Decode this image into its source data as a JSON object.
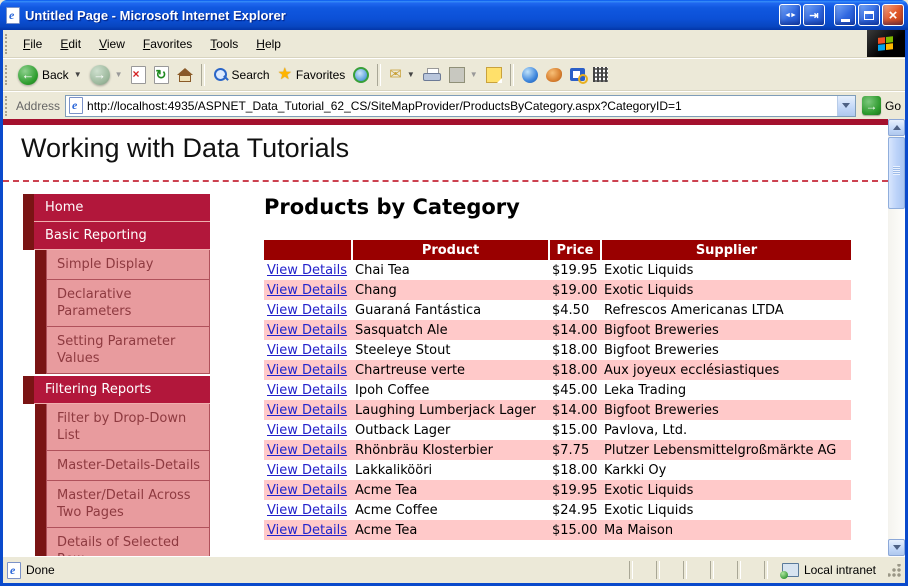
{
  "window": {
    "title": "Untitled Page - Microsoft Internet Explorer"
  },
  "menu_bar": {
    "items": [
      "File",
      "Edit",
      "View",
      "Favorites",
      "Tools",
      "Help"
    ]
  },
  "toolbar": {
    "back_label": "Back",
    "search_label": "Search",
    "favorites_label": "Favorites"
  },
  "address_bar": {
    "label": "Address",
    "url": "http://localhost:4935/ASPNET_Data_Tutorial_62_CS/SiteMapProvider/ProductsByCategory.aspx?CategoryID=1",
    "go_label": "Go"
  },
  "page": {
    "site_title": "Working with Data Tutorials",
    "heading": "Products by Category",
    "sidebar": [
      {
        "label": "Home",
        "level": 1
      },
      {
        "label": "Basic Reporting",
        "level": 1
      },
      {
        "label": "Simple Display",
        "level": 2
      },
      {
        "label": "Declarative Parameters",
        "level": 2
      },
      {
        "label": "Setting Parameter Values",
        "level": 2
      },
      {
        "label": "Filtering Reports",
        "level": 1
      },
      {
        "label": "Filter by Drop-Down List",
        "level": 2
      },
      {
        "label": "Master-Details-Details",
        "level": 2
      },
      {
        "label": "Master/Detail Across Two Pages",
        "level": 2
      },
      {
        "label": "Details of Selected Row",
        "level": 2
      }
    ],
    "table": {
      "headers": [
        "",
        "Product",
        "Price",
        "Supplier"
      ],
      "link_label": "View Details",
      "rows": [
        {
          "product": "Chai Tea",
          "price": "$19.95",
          "supplier": "Exotic Liquids"
        },
        {
          "product": "Chang",
          "price": "$19.00",
          "supplier": "Exotic Liquids"
        },
        {
          "product": "Guaraná Fantástica",
          "price": "$4.50",
          "supplier": "Refrescos Americanas LTDA"
        },
        {
          "product": "Sasquatch Ale",
          "price": "$14.00",
          "supplier": "Bigfoot Breweries"
        },
        {
          "product": "Steeleye Stout",
          "price": "$18.00",
          "supplier": "Bigfoot Breweries"
        },
        {
          "product": "Chartreuse verte",
          "price": "$18.00",
          "supplier": "Aux joyeux ecclésiastiques"
        },
        {
          "product": "Ipoh Coffee",
          "price": "$45.00",
          "supplier": "Leka Trading"
        },
        {
          "product": "Laughing Lumberjack Lager",
          "price": "$14.00",
          "supplier": "Bigfoot Breweries"
        },
        {
          "product": "Outback Lager",
          "price": "$15.00",
          "supplier": "Pavlova, Ltd."
        },
        {
          "product": "Rhönbräu Klosterbier",
          "price": "$7.75",
          "supplier": "Plutzer Lebensmittelgroßmärkte AG"
        },
        {
          "product": "Lakkalikööri",
          "price": "$18.00",
          "supplier": "Karkki Oy"
        },
        {
          "product": "Acme Tea",
          "price": "$19.95",
          "supplier": "Exotic Liquids"
        },
        {
          "product": "Acme Coffee",
          "price": "$24.95",
          "supplier": "Exotic Liquids"
        },
        {
          "product": "Acme Tea",
          "price": "$15.00",
          "supplier": "Ma Maison"
        }
      ]
    }
  },
  "status_bar": {
    "status": "Done",
    "zone": "Local intranet"
  },
  "colors": {
    "titlebar_blue": "#1058E0",
    "chrome_beige": "#ECE9D8",
    "page_bar_red": "#A4112E",
    "sidebar_crimson": "#B2173B",
    "sidebar_accent_maroon": "#7A1414",
    "sidebar_sub_pink": "#E89B9E",
    "table_header_red": "#990000",
    "row_alt_pink": "#FFC9C9",
    "link_blue": "#2222CC",
    "go_green": "#2D9A2D"
  }
}
